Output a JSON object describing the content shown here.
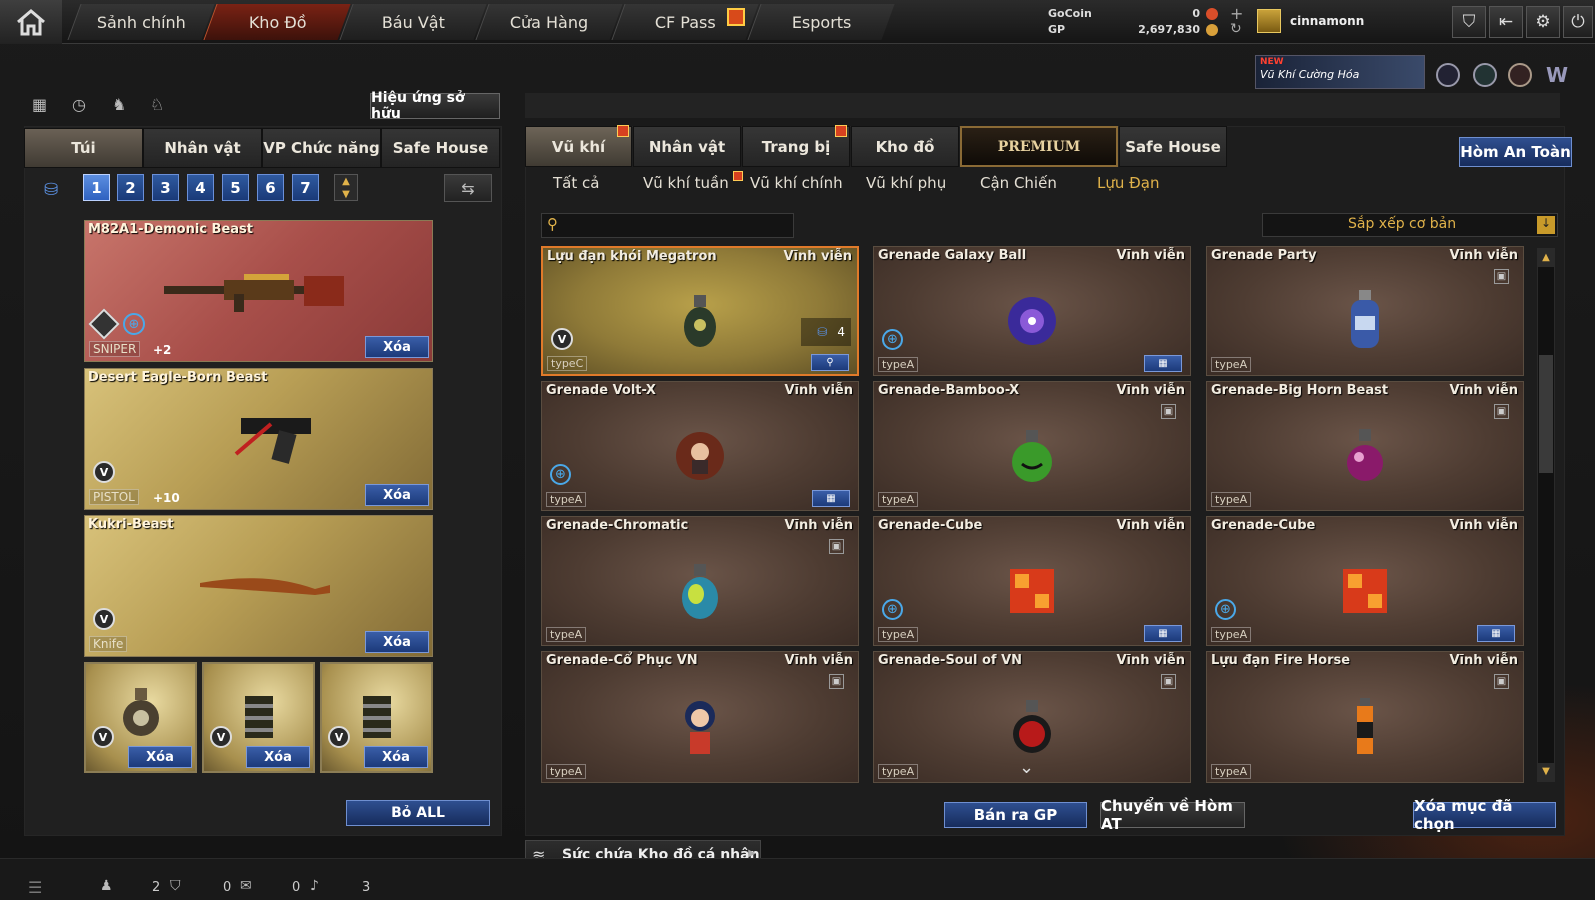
{
  "nav": {
    "tabs": [
      "Sảnh chính",
      "Kho Đồ",
      "Báu Vật",
      "Cửa Hàng",
      "CF Pass",
      "Esports"
    ],
    "active": "Kho Đồ"
  },
  "currency": {
    "gocoin_label": "GoCoin",
    "gocoin_value": "0",
    "gp_label": "GP",
    "gp_value": "2,697,830"
  },
  "user": {
    "name": "cinnamonn"
  },
  "banner": {
    "new": "NEW",
    "text": "Vũ Khí Cường Hóa"
  },
  "left": {
    "owned_effect_button": "Hiệu ứng sở hữu",
    "tabs": [
      "Túi",
      "Nhân vật",
      "VP Chức năng",
      "Safe House"
    ],
    "active_tab": "Túi",
    "pages": [
      "1",
      "2",
      "3",
      "4",
      "5",
      "6",
      "7"
    ],
    "active_page": "1",
    "items": [
      {
        "name": "M82A1-Demonic Beast",
        "category": "SNIPER",
        "bonus": "+2",
        "delete": "Xóa"
      },
      {
        "name": "Desert Eagle-Born Beast",
        "category": "PISTOL",
        "bonus": "+10",
        "delete": "Xóa"
      },
      {
        "name": "Kukri-Beast",
        "category": "Knife",
        "bonus": "",
        "delete": "Xóa"
      }
    ],
    "grenade_slots": [
      {
        "delete": "Xóa"
      },
      {
        "delete": "Xóa"
      },
      {
        "delete": "Xóa"
      }
    ],
    "remove_all": "Bỏ ALL"
  },
  "right": {
    "tabs": [
      "Vũ khí",
      "Nhân vật",
      "Trang bị",
      "Kho đồ",
      "PREMIUM",
      "Safe House"
    ],
    "active_tab": "Vũ khí",
    "safe_box": "Hòm An Toàn",
    "subtabs": [
      "Tất cả",
      "Vũ khí tuần",
      "Vũ khí chính",
      "Vũ khí phụ",
      "Cận Chiến",
      "Lựu Đạn"
    ],
    "active_subtab": "Lựu Đạn",
    "search_placeholder": "",
    "sort": "Sắp xếp cơ bản",
    "items": [
      {
        "name": "Lựu đạn khói Megatron",
        "duration": "Vĩnh viễn",
        "type": "typeC",
        "count": "4"
      },
      {
        "name": "Grenade Galaxy Ball",
        "duration": "Vĩnh viễn",
        "type": "typeA"
      },
      {
        "name": "Grenade Party",
        "duration": "Vĩnh viễn",
        "type": "typeA"
      },
      {
        "name": "Grenade Volt-X",
        "duration": "Vĩnh viễn",
        "type": "typeA"
      },
      {
        "name": "Grenade-Bamboo-X",
        "duration": "Vĩnh viễn",
        "type": "typeA"
      },
      {
        "name": "Grenade-Big Horn Beast",
        "duration": "Vĩnh viễn",
        "type": "typeA"
      },
      {
        "name": "Grenade-Chromatic",
        "duration": "Vĩnh viễn",
        "type": "typeA"
      },
      {
        "name": "Grenade-Cube",
        "duration": "Vĩnh viễn",
        "type": "typeA"
      },
      {
        "name": "Grenade-Cube",
        "duration": "Vĩnh viễn",
        "type": "typeA"
      },
      {
        "name": "Grenade-Cổ Phục VN",
        "duration": "Vĩnh viễn",
        "type": "typeA"
      },
      {
        "name": "Grenade-Soul of VN",
        "duration": "Vĩnh viễn",
        "type": "typeA"
      },
      {
        "name": "Lựu đạn Fire Horse",
        "duration": "Vĩnh viễn",
        "type": "typeA"
      }
    ],
    "sell_button": "Bán ra GP",
    "transfer_button": "Chuyển về Hòm AT",
    "delete_selected": "Xóa mục đã chọn",
    "capacity_label": "Sức chứa Kho đồ cá nhân"
  },
  "status": {
    "v1": "2",
    "v2": "0",
    "v3": "0",
    "v4": "3"
  }
}
